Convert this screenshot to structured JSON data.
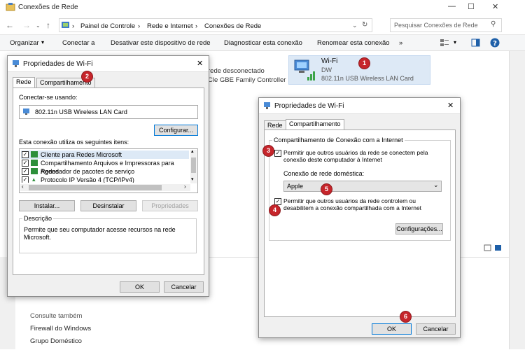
{
  "window": {
    "title": "Conexões de Rede",
    "minimize": "—",
    "maximize": "☐",
    "close": "✕"
  },
  "address": {
    "back": "←",
    "forward": "→",
    "up": "↑",
    "crumbs": [
      "Painel de Controle",
      "Rede e Internet",
      "Conexões de Rede"
    ],
    "sep": "›",
    "search_placeholder": "Pesquisar Conexões de Rede"
  },
  "toolbar": {
    "organize": "Organizar",
    "connect": "Conectar a",
    "disable": "Desativar este dispositivo de rede",
    "diagnose": "Diagnosticar esta conexão",
    "rename": "Renomear esta conexão",
    "more": "»"
  },
  "content": {
    "eth_status": "rede desconectado",
    "eth_device": "Cle GBE Family Controller",
    "wifi": {
      "name": "Wi-Fi",
      "network": "DW",
      "device": "802.11n USB Wireless LAN Card"
    }
  },
  "see_also": {
    "heading": "Consulte também",
    "links": [
      "Firewall do Windows",
      "Grupo Doméstico"
    ]
  },
  "dialog1": {
    "title": "Propriedades de Wi-Fi",
    "tabs": [
      "Rede",
      "Compartilhamento"
    ],
    "connect_using_label": "Conectar-se usando:",
    "adapter": "802.11n USB Wireless LAN Card",
    "configure_btn": "Configurar...",
    "items_label": "Esta conexão utiliza os seguintes itens:",
    "items": [
      "Cliente para Redes Microsoft",
      "Compartilhamento Arquivos e Impressoras para Redes",
      "Agendador de pacotes de serviço",
      "Protocolo IP Versão 4 (TCP/IPv4)"
    ],
    "install_btn": "Instalar...",
    "uninstall_btn": "Desinstalar",
    "properties_btn": "Propriedades",
    "description_label": "Descrição",
    "description": "Permite que seu computador acesse recursos na rede Microsoft.",
    "ok": "OK",
    "cancel": "Cancelar"
  },
  "dialog2": {
    "title": "Propriedades de Wi-Fi",
    "tabs": [
      "Rede",
      "Compartilhamento"
    ],
    "group_label": "Compartilhamento de Conexão com a Internet",
    "allow_connect": "Permitir que outros usuários da rede se conectem pela conexão deste computador à Internet",
    "home_conn_label": "Conexão de rede doméstica:",
    "home_conn_value": "Apple",
    "allow_control": "Permitir que outros usuários da rede controlem ou desabilitem a conexão compartilhada com a Internet",
    "settings_btn": "Configurações...",
    "ok": "OK",
    "cancel": "Cancelar"
  },
  "badges": [
    "1",
    "2",
    "3",
    "4",
    "5",
    "6"
  ],
  "colors": {
    "badge": "#c6252b",
    "accent": "#0078d7",
    "selection": "#dde9f6"
  }
}
